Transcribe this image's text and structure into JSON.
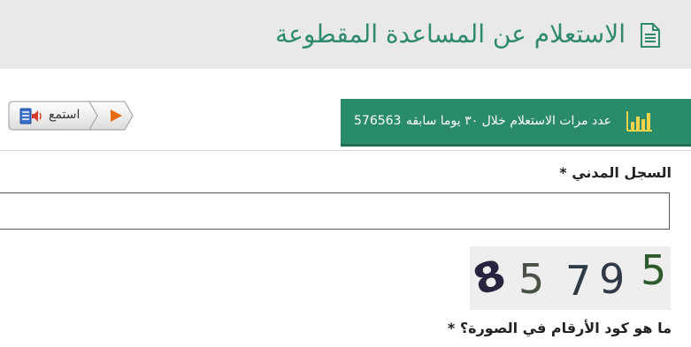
{
  "header": {
    "title": "الاستعلام عن المساعدة المقطوعة",
    "icon": "document-icon",
    "accent_color": "#2e8a6e"
  },
  "listen": {
    "label": "استمع",
    "speaker_icon": "speaker-icon",
    "play_icon": "play-icon"
  },
  "stats": {
    "text": "عدد مرات الاستعلام خلال ٣٠ يوما سابقه",
    "count": "576563",
    "icon": "bar-chart-icon",
    "background": "#2a8a6c"
  },
  "form": {
    "civil_record_label": "السجل المدني *",
    "civil_record_value": "",
    "captcha_digits": [
      "8",
      "5",
      "7",
      "9",
      "5"
    ],
    "captcha_label": "ما هو كود الأرقام في الصورة؟ *"
  }
}
